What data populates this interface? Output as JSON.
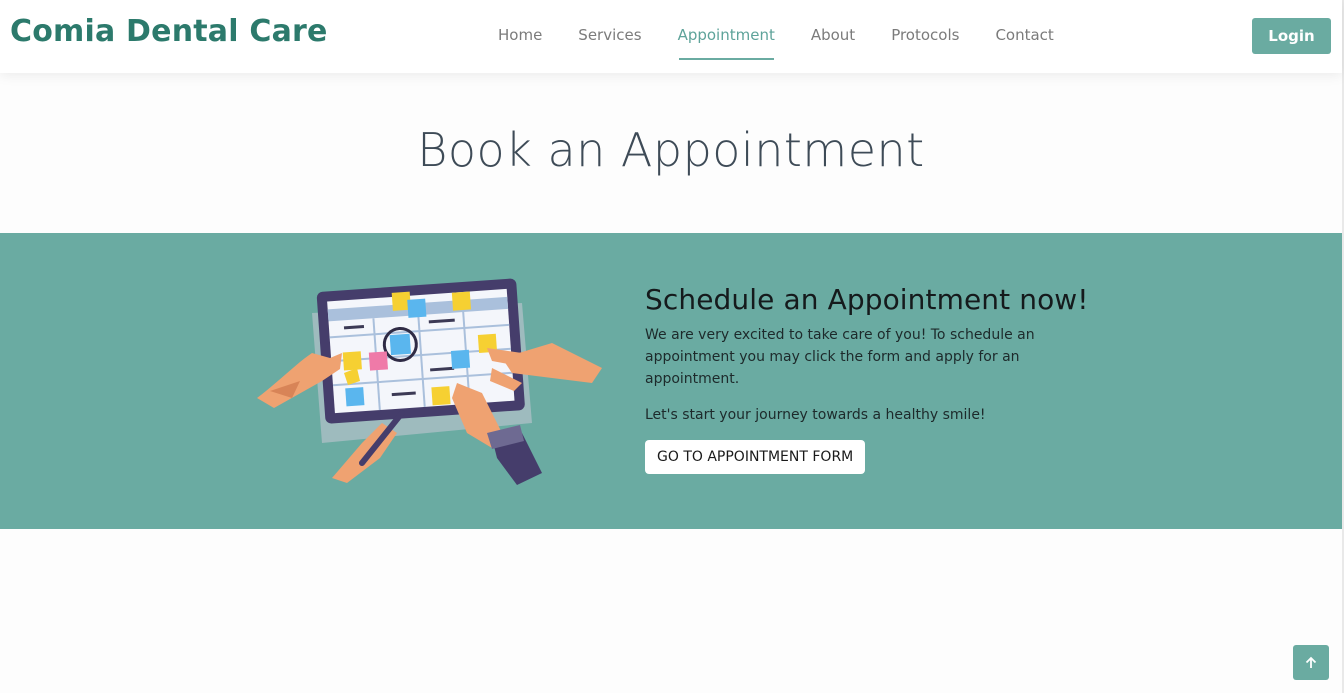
{
  "header": {
    "brand": "Comia Dental Care",
    "nav": [
      {
        "label": "Home"
      },
      {
        "label": "Services"
      },
      {
        "label": "Appointment"
      },
      {
        "label": "About"
      },
      {
        "label": "Protocols"
      },
      {
        "label": "Contact"
      }
    ],
    "active_nav": "Appointment",
    "login_label": "Login"
  },
  "main": {
    "title": "Book an Appointment",
    "cta": {
      "heading": "Schedule an Appointment now!",
      "intro": "We are very excited to take care of you! To schedule an appointment you may click the form and apply for an appointment.",
      "tagline": "Let's start your journey towards a healthy smile!",
      "button_label": "GO TO APPOINTMENT FORM"
    }
  },
  "colors": {
    "brand": "#2c7a6c",
    "accent": "#6aaba1",
    "band": "#6aaba2"
  },
  "icons": {
    "back_to_top": "arrow-up-icon",
    "illustration": "calendar-planning-illustration"
  }
}
